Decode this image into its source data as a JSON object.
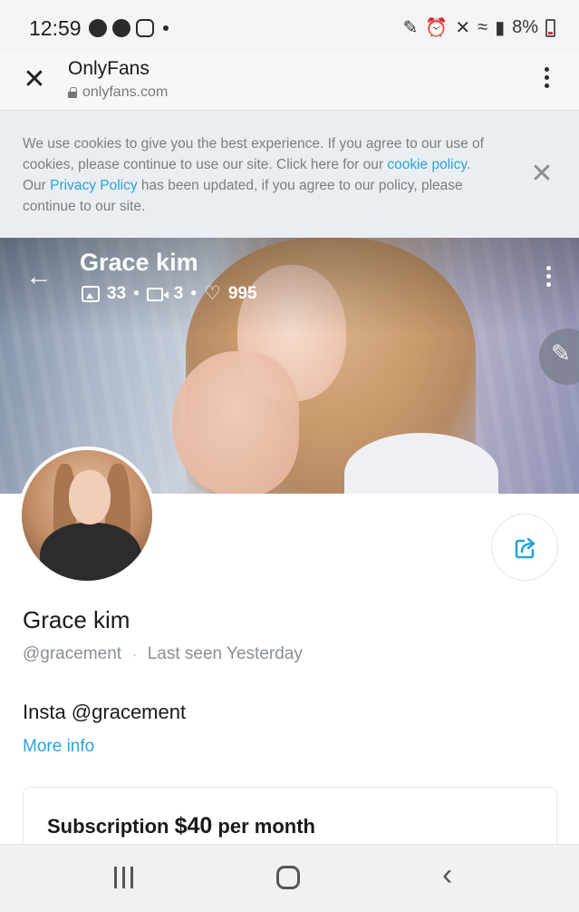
{
  "status_bar": {
    "time": "12:59",
    "battery": "8%",
    "icons": [
      "messenger-icon",
      "messenger-icon",
      "instagram-icon",
      "dot-icon",
      "pen-icon",
      "alarm-icon",
      "mute-icon",
      "wifi-icon",
      "signal-icon",
      "battery-icon"
    ]
  },
  "browser": {
    "title": "OnlyFans",
    "url": "onlyfans.com"
  },
  "cookie_banner": {
    "text_part1": "We use cookies to give you the best experience. If you agree to our use of cookies, please continue to use our site. Click here for our ",
    "cookie_link": "cookie policy",
    "text_part2": ". Our ",
    "privacy_link": "Privacy Policy",
    "text_part3": " has been updated, if you agree to our policy, please continue to our site."
  },
  "cover": {
    "name": "Grace kim",
    "images_count": "33",
    "videos_count": "3",
    "likes_count": "995",
    "separator": "•"
  },
  "profile": {
    "name": "Grace kim",
    "handle": "@gracement",
    "meta_separator": "·",
    "last_seen": "Last seen Yesterday",
    "bio": "Insta @gracement",
    "more_info": "More info"
  },
  "subscription": {
    "label": "Subscription",
    "price": "$40",
    "period": "per month"
  },
  "colors": {
    "accent": "#2aa3d6",
    "banner_bg": "#eaeef2",
    "muted_text": "#8a8f96"
  }
}
